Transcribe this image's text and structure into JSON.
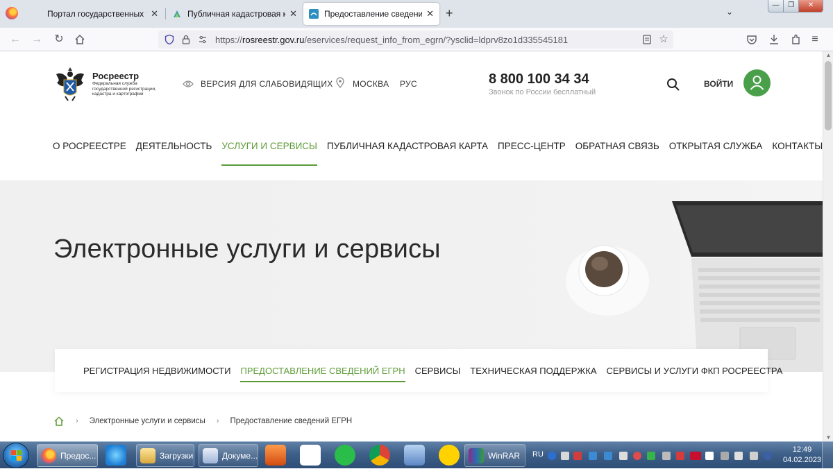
{
  "browser": {
    "tabs": [
      {
        "title": "Портал государственных услуг"
      },
      {
        "title": "Публичная кадастровая карта"
      },
      {
        "title": "Предоставление сведений ЕГРН",
        "active": true
      }
    ],
    "url_prefix": "https://",
    "url_host": "rosreestr.gov.ru",
    "url_path": "/eservices/request_info_from_egrn/?ysclid=ldprv8zo1d335545181"
  },
  "header": {
    "logo_name": "Росреестр",
    "logo_subtitle": "Федеральная служба государственной регистрации, кадастра и картографии",
    "accessibility": "ВЕРСИЯ ДЛЯ СЛАБОВИДЯЩИХ",
    "city": "МОСКВА",
    "lang": "РУС",
    "phone": "8 800 100 34 34",
    "phone_note": "Звонок по России бесплатный",
    "login": "ВОЙТИ"
  },
  "main_nav": [
    {
      "label": "О РОСРЕЕСТРЕ"
    },
    {
      "label": "ДЕЯТЕЛЬНОСТЬ"
    },
    {
      "label": "УСЛУГИ И СЕРВИСЫ",
      "active": true
    },
    {
      "label": "ПУБЛИЧНАЯ КАДАСТРОВАЯ КАРТА"
    },
    {
      "label": "ПРЕСС-ЦЕНТР"
    },
    {
      "label": "ОБРАТНАЯ СВЯЗЬ"
    },
    {
      "label": "ОТКРЫТАЯ СЛУЖБА"
    },
    {
      "label": "КОНТАКТЫ"
    }
  ],
  "hero": {
    "title": "Электронные услуги и сервисы"
  },
  "sub_nav": [
    {
      "label": "РЕГИСТРАЦИЯ НЕДВИЖИМОСТИ"
    },
    {
      "label": "ПРЕДОСТАВЛЕНИЕ СВЕДЕНИЙ ЕГРН",
      "active": true
    },
    {
      "label": "СЕРВИСЫ"
    },
    {
      "label": "ТЕХНИЧЕСКАЯ ПОДДЕРЖКА"
    },
    {
      "label": "СЕРВИСЫ И УСЛУГИ ФКП РОСРЕЕСТРА"
    }
  ],
  "breadcrumb": [
    "Электронные услуги и сервисы",
    "Предоставление сведений ЕГРН"
  ],
  "taskbar": {
    "buttons": [
      {
        "label": "Предос..."
      },
      {
        "label": "Загрузки"
      },
      {
        "label": "Докуме..."
      },
      {
        "label": "WinRAR"
      }
    ],
    "lang": "RU",
    "time": "12:49",
    "date": "04.02.2023"
  },
  "colors": {
    "accent_green": "#5d9a36",
    "avatar_green": "#4aa04a",
    "taskbar_blue": "#3e5f88"
  }
}
